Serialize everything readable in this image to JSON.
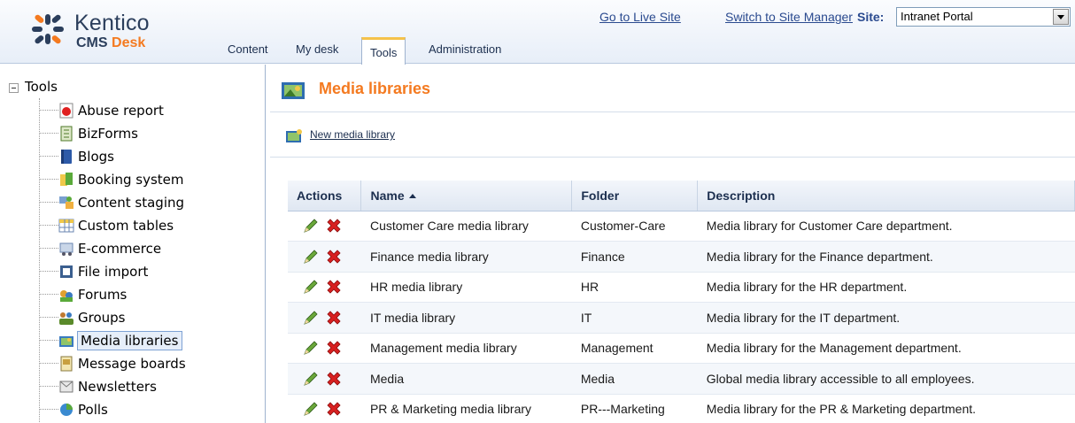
{
  "brand": {
    "name": "Kentico",
    "product_prefix": "CMS",
    "product_suffix": "Desk",
    "accent_color": "#f47a20",
    "brand_color": "#2b3e5c"
  },
  "header": {
    "links": [
      {
        "label": "Go to Live Site"
      },
      {
        "label": "Switch to Site Manager"
      }
    ],
    "site_label": "Site:",
    "site_value": "Intranet Portal",
    "tabs": [
      {
        "label": "Content",
        "active": false
      },
      {
        "label": "My desk",
        "active": false
      },
      {
        "label": "Tools",
        "active": true
      },
      {
        "label": "Administration",
        "active": false
      }
    ]
  },
  "tree": {
    "root": "Tools",
    "items": [
      {
        "label": "Abuse report",
        "icon": "abuse-report-icon"
      },
      {
        "label": "BizForms",
        "icon": "bizforms-icon"
      },
      {
        "label": "Blogs",
        "icon": "blogs-icon"
      },
      {
        "label": "Booking system",
        "icon": "booking-system-icon"
      },
      {
        "label": "Content staging",
        "icon": "content-staging-icon"
      },
      {
        "label": "Custom tables",
        "icon": "custom-tables-icon"
      },
      {
        "label": "E-commerce",
        "icon": "ecommerce-icon"
      },
      {
        "label": "File import",
        "icon": "file-import-icon"
      },
      {
        "label": "Forums",
        "icon": "forums-icon"
      },
      {
        "label": "Groups",
        "icon": "groups-icon"
      },
      {
        "label": "Media libraries",
        "icon": "media-libraries-icon",
        "selected": true
      },
      {
        "label": "Message boards",
        "icon": "message-boards-icon"
      },
      {
        "label": "Newsletters",
        "icon": "newsletters-icon"
      },
      {
        "label": "Polls",
        "icon": "polls-icon"
      }
    ]
  },
  "main": {
    "title": "Media libraries",
    "new_link": "New media library",
    "columns": {
      "actions": "Actions",
      "name": "Name",
      "folder": "Folder",
      "description": "Description"
    },
    "rows": [
      {
        "name": "Customer Care media library",
        "folder": "Customer-Care",
        "description": "Media library for Customer Care department."
      },
      {
        "name": "Finance media library",
        "folder": "Finance",
        "description": "Media library for the Finance department."
      },
      {
        "name": "HR media library",
        "folder": "HR",
        "description": "Media library for the HR department."
      },
      {
        "name": "IT media library",
        "folder": "IT",
        "description": "Media library for the IT department."
      },
      {
        "name": "Management media library",
        "folder": "Management",
        "description": "Media library for the Management department."
      },
      {
        "name": "Media",
        "folder": "Media",
        "description": "Global media library accessible to all employees."
      },
      {
        "name": "PR & Marketing media library",
        "folder": "PR---Marketing",
        "description": "Media library for the PR & Marketing department."
      }
    ]
  }
}
